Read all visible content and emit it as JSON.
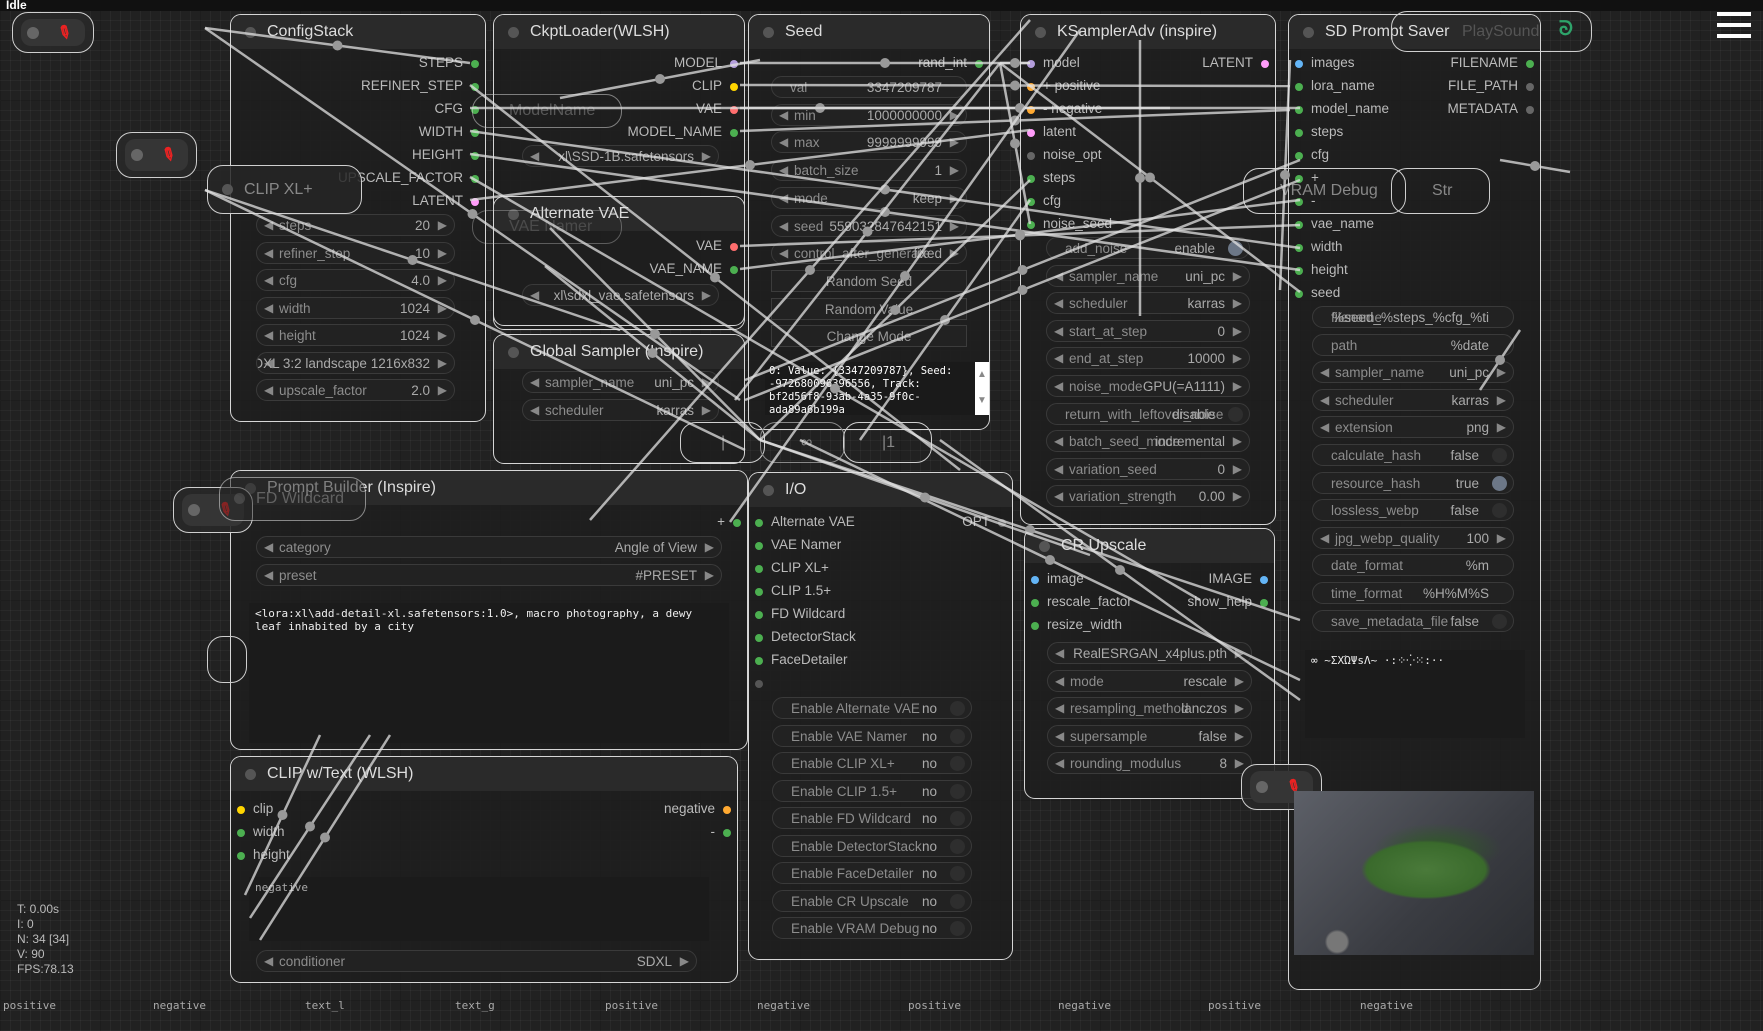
{
  "app": {
    "status": "Idle",
    "menu_icon": "hamburger-menu-icon"
  },
  "stats": {
    "time": "T: 0.00s",
    "iterations": "I: 0",
    "nodes": "N: 34 [34]",
    "vertices": "V: 90",
    "fps": "FPS:78.13"
  },
  "colors": {
    "int": "#4caf50",
    "model": "#b39ddb",
    "clip": "#ffd500",
    "vae": "#ff6e6e",
    "latent": "#ff9cf9",
    "cond": "#ffa931",
    "image": "#64b5f6",
    "none": "#666666"
  },
  "nodes": {
    "configstack": {
      "title": "ConfigStack",
      "slots": [
        {
          "out": "STEPS",
          "oc": "#4caf50"
        },
        {
          "out": "REFINER_STEP",
          "oc": "#4caf50"
        },
        {
          "out": "CFG",
          "oc": "#4caf50"
        },
        {
          "out": "WIDTH",
          "oc": "#4caf50"
        },
        {
          "out": "HEIGHT",
          "oc": "#4caf50"
        },
        {
          "out": "UPSCALE_FACTOR",
          "oc": "#4caf50"
        },
        {
          "out": "LATENT",
          "oc": "#ff9cf9"
        }
      ],
      "widgets": [
        {
          "t": "num",
          "label": "steps",
          "value": "20"
        },
        {
          "t": "num",
          "label": "refiner_step",
          "value": "10"
        },
        {
          "t": "num",
          "label": "cfg",
          "value": "4.0"
        },
        {
          "t": "num",
          "label": "width",
          "value": "1024"
        },
        {
          "t": "num",
          "label": "height",
          "value": "1024"
        },
        {
          "t": "num",
          "label": "",
          "value": "SDXL 3:2 landscape 1216x832"
        },
        {
          "t": "num",
          "label": "upscale_factor",
          "value": "2.0"
        }
      ]
    },
    "ckpt": {
      "title": "CkptLoader(WLSH)",
      "slots": [
        {
          "out": "MODEL",
          "oc": "#b39ddb"
        },
        {
          "out": "CLIP",
          "oc": "#ffd500"
        },
        {
          "out": "VAE",
          "oc": "#ff6e6e"
        },
        {
          "out": "MODEL_NAME",
          "oc": "#4caf50"
        }
      ],
      "widgets": [
        {
          "t": "num",
          "label": "",
          "value": "xl\\SSD-1B.safetensors"
        }
      ]
    },
    "altvae": {
      "title": "Alternate VAE",
      "slots": [
        {
          "out": "VAE",
          "oc": "#ff6e6e"
        },
        {
          "out": "VAE_NAME",
          "oc": "#4caf50"
        }
      ],
      "widgets": [
        {
          "t": "num",
          "label": "",
          "value": "xl\\sdxl_vae.safetensors"
        }
      ]
    },
    "globalsampler": {
      "title": "Global Sampler (Inspire)",
      "slots": [],
      "widgets": [
        {
          "t": "num",
          "label": "sampler_name",
          "value": "uni_pc"
        },
        {
          "t": "num",
          "label": "scheduler",
          "value": "karras"
        }
      ]
    },
    "seed": {
      "title": "Seed",
      "slots": [
        {
          "out": "rand_int",
          "oc": "#4caf50"
        }
      ],
      "widgets": [
        {
          "t": "text",
          "label": "val",
          "value": "3347209787"
        },
        {
          "t": "num",
          "label": "min",
          "value": "1000000000"
        },
        {
          "t": "num",
          "label": "max",
          "value": "9999999999"
        },
        {
          "t": "num",
          "label": "batch_size",
          "value": "1"
        },
        {
          "t": "num",
          "label": "mode",
          "value": "keep"
        },
        {
          "t": "num",
          "label": "seed",
          "value": "559032847642151"
        },
        {
          "t": "num",
          "label": "control_after_generate",
          "value": "fixed"
        },
        {
          "t": "btn",
          "label": "Random Seed"
        },
        {
          "t": "btn",
          "label": "Random Value"
        },
        {
          "t": "btn",
          "label": "Change Mode"
        }
      ],
      "tooltip": "0: Value: {3347209787}, Seed: -972680096396556, Track: bf2d56f8-93ab-4a35-9f0c-ada89a6b199a"
    },
    "ksampler": {
      "title": "KSamplerAdv (inspire)",
      "slots": [
        {
          "in": "model",
          "ic": "#b39ddb",
          "out": "LATENT",
          "oc": "#ff9cf9"
        },
        {
          "in": "+ positive",
          "ic": "#ffa931"
        },
        {
          "in": "- negative",
          "ic": "#ffa931"
        },
        {
          "in": "latent",
          "ic": "#ff9cf9"
        },
        {
          "in": "noise_opt",
          "ic": "#666666"
        },
        {
          "in": "steps",
          "ic": "#4caf50"
        },
        {
          "in": "cfg",
          "ic": "#4caf50"
        },
        {
          "in": "noise_seed",
          "ic": "#4caf50"
        }
      ],
      "widgets": [
        {
          "t": "toggle",
          "label": "add_noise",
          "value": "enable",
          "on": true
        },
        {
          "t": "num",
          "label": "sampler_name",
          "value": "uni_pc"
        },
        {
          "t": "num",
          "label": "scheduler",
          "value": "karras"
        },
        {
          "t": "num",
          "label": "start_at_step",
          "value": "0"
        },
        {
          "t": "num",
          "label": "end_at_step",
          "value": "10000"
        },
        {
          "t": "num",
          "label": "noise_mode",
          "value": "GPU(=A1111)"
        },
        {
          "t": "toggle",
          "label": "return_with_leftover_noise",
          "value": "disable",
          "on": false
        },
        {
          "t": "num",
          "label": "batch_seed_mode",
          "value": "incremental"
        },
        {
          "t": "num",
          "label": "variation_seed",
          "value": "0"
        },
        {
          "t": "num",
          "label": "variation_strength",
          "value": "0.00"
        }
      ]
    },
    "crupscale": {
      "title": "CR Upscale",
      "slots": [
        {
          "in": "image",
          "ic": "#64b5f6",
          "out": "IMAGE",
          "oc": "#64b5f6"
        },
        {
          "in": "rescale_factor",
          "ic": "#4caf50",
          "out": "show_help",
          "oc": "#4caf50"
        },
        {
          "in": "resize_width",
          "ic": "#4caf50"
        }
      ],
      "widgets": [
        {
          "t": "num",
          "label": "",
          "value": "RealESRGAN_x4plus.pth"
        },
        {
          "t": "num",
          "label": "mode",
          "value": "rescale"
        },
        {
          "t": "num",
          "label": "resampling_method",
          "value": "lanczos"
        },
        {
          "t": "num",
          "label": "supersample",
          "value": "false"
        },
        {
          "t": "num",
          "label": "rounding_modulus",
          "value": "8"
        }
      ]
    },
    "saver": {
      "title": "SD Prompt Saver",
      "slots": [
        {
          "in": "images",
          "ic": "#64b5f6",
          "out": "FILENAME",
          "oc": "#4caf50"
        },
        {
          "in": "lora_name",
          "ic": "#4caf50",
          "out": "FILE_PATH",
          "oc": "#666666"
        },
        {
          "in": "model_name",
          "ic": "#4caf50",
          "out": "METADATA",
          "oc": "#666666"
        },
        {
          "in": "steps",
          "ic": "#4caf50"
        },
        {
          "in": "cfg",
          "ic": "#4caf50"
        },
        {
          "in": "+",
          "ic": "#4caf50"
        },
        {
          "in": "-",
          "ic": "#4caf50"
        },
        {
          "in": "vae_name",
          "ic": "#4caf50"
        },
        {
          "in": "width",
          "ic": "#4caf50"
        },
        {
          "in": "height",
          "ic": "#4caf50"
        },
        {
          "in": "seed",
          "ic": "#4caf50"
        }
      ],
      "widgets": [
        {
          "t": "text",
          "label": "filename",
          "value": "%seed_%steps_%cfg_%ti"
        },
        {
          "t": "text",
          "label": "path",
          "value": "%date"
        },
        {
          "t": "num",
          "label": "sampler_name",
          "value": "uni_pc"
        },
        {
          "t": "num",
          "label": "scheduler",
          "value": "karras"
        },
        {
          "t": "num",
          "label": "extension",
          "value": "png"
        },
        {
          "t": "toggle",
          "label": "calculate_hash",
          "value": "false",
          "on": false
        },
        {
          "t": "toggle",
          "label": "resource_hash",
          "value": "true",
          "on": true
        },
        {
          "t": "toggle",
          "label": "lossless_webp",
          "value": "false",
          "on": false
        },
        {
          "t": "num",
          "label": "jpg_webp_quality",
          "value": "100"
        },
        {
          "t": "text",
          "label": "date_format",
          "value": "%m"
        },
        {
          "t": "text",
          "label": "time_format",
          "value": "%H%M%S"
        },
        {
          "t": "toggle",
          "label": "save_metadata_file",
          "value": "false",
          "on": false
        }
      ],
      "output_text": "∞ ~ΣXΏΨsΛ~ ·:⁘⁛⁙:··"
    },
    "io": {
      "title": "I/O",
      "slots": [
        {
          "in": "Alternate VAE",
          "ic": "#4caf50",
          "out": "OPT",
          "oc": "#666666"
        },
        {
          "in": "VAE Namer",
          "ic": "#4caf50"
        },
        {
          "in": "CLIP XL+",
          "ic": "#4caf50"
        },
        {
          "in": "CLIP 1.5+",
          "ic": "#4caf50"
        },
        {
          "in": "FD Wildcard",
          "ic": "#4caf50"
        },
        {
          "in": "DetectorStack",
          "ic": "#4caf50"
        },
        {
          "in": "FaceDetailer",
          "ic": "#4caf50"
        },
        {
          "in": "",
          "ic": "#555555"
        }
      ],
      "widgets": [
        {
          "t": "toggle",
          "label": "Enable Alternate VAE",
          "value": "no"
        },
        {
          "t": "toggle",
          "label": "Enable VAE Namer",
          "value": "no"
        },
        {
          "t": "toggle",
          "label": "Enable CLIP XL+",
          "value": "no"
        },
        {
          "t": "toggle",
          "label": "Enable CLIP 1.5+",
          "value": "no"
        },
        {
          "t": "toggle",
          "label": "Enable FD Wildcard",
          "value": "no"
        },
        {
          "t": "toggle",
          "label": "Enable DetectorStack",
          "value": "no"
        },
        {
          "t": "toggle",
          "label": "Enable FaceDetailer",
          "value": "no"
        },
        {
          "t": "toggle",
          "label": "Enable CR Upscale",
          "value": "no"
        },
        {
          "t": "toggle",
          "label": "Enable VRAM Debug",
          "value": "no"
        }
      ]
    },
    "promptbuilder": {
      "title": "Prompt Builder (Inspire)",
      "slots": [
        {
          "out": "+",
          "oc": "#4caf50"
        }
      ],
      "widgets": [
        {
          "t": "num",
          "label": "category",
          "value": "Angle of View"
        },
        {
          "t": "num",
          "label": "preset",
          "value": "#PRESET"
        }
      ],
      "text": "<lora:xl\\add-detail-xl.safetensors:1.0>, macro photography, a dewy leaf inhabited by a city"
    },
    "clipwtext": {
      "title": "CLIP w/Text (WLSH)",
      "slots": [
        {
          "in": "clip",
          "ic": "#ffd500",
          "out": "negative",
          "oc": "#ffa931"
        },
        {
          "in": "width",
          "ic": "#4caf50",
          "out": "-",
          "oc": "#4caf50"
        },
        {
          "in": "height",
          "ic": "#4caf50"
        }
      ],
      "widgets": [
        {
          "t": "num",
          "label": "conditioner",
          "value": "SDXL"
        }
      ],
      "text": "negative"
    }
  },
  "collapsed": {
    "clipxl": "CLIP XL+",
    "modelname": "ModelName",
    "vaenamer": "VAE Namer",
    "fdwildcard": "FD Wildcard",
    "vramdebug": "VRAM Debug",
    "str": "Str",
    "playsound": "PlaySound",
    "reroute_inf": "∞",
    "reroute_one": "|1"
  },
  "bottom_labels": [
    "positive",
    "negative",
    "text_l",
    "text_g",
    "positive",
    "negative",
    "positive",
    "negative",
    "positive",
    "negative"
  ]
}
